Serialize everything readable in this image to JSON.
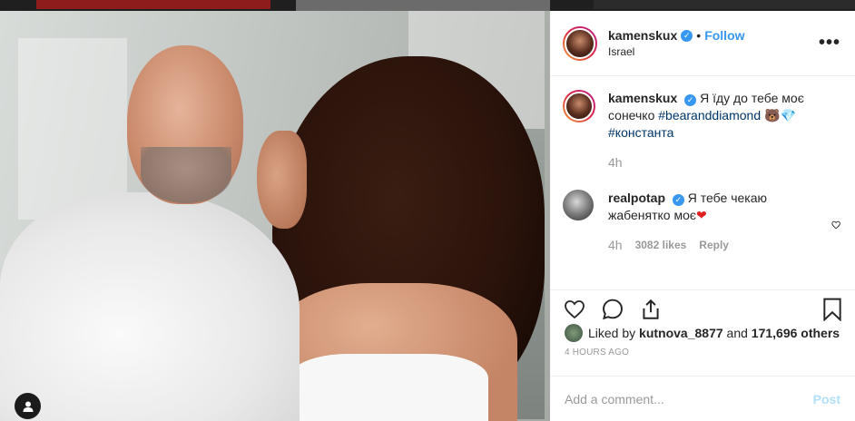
{
  "post": {
    "author": "kamenskux",
    "follow_label": "Follow",
    "dot": "•",
    "location": "Israel",
    "more_icon": "more-dots-icon",
    "more_label": "•••"
  },
  "caption": {
    "user": "kamenskux",
    "text": "Я їду до тебе моє сонечко",
    "tag1": "#bearanddiamond",
    "emoji": "🐻💎",
    "tag2": "#константа",
    "time": "4h"
  },
  "comment": {
    "user": "realpotap",
    "text": "Я тебе чекаю жабенятко моє",
    "emoji": "❤",
    "time": "4h",
    "likes": "3082 likes",
    "reply": "Reply"
  },
  "likes": {
    "prefix": "Liked by",
    "user": "kutnova_8877",
    "and": "and",
    "count": "171,696 others"
  },
  "timeago": "4 HOURS AGO",
  "add_comment": {
    "placeholder": "Add a comment...",
    "post_label": "Post"
  },
  "colors": {
    "accent": "#3897f0",
    "post_disabled": "#b2dffc",
    "heart_red": "#ed4956"
  }
}
